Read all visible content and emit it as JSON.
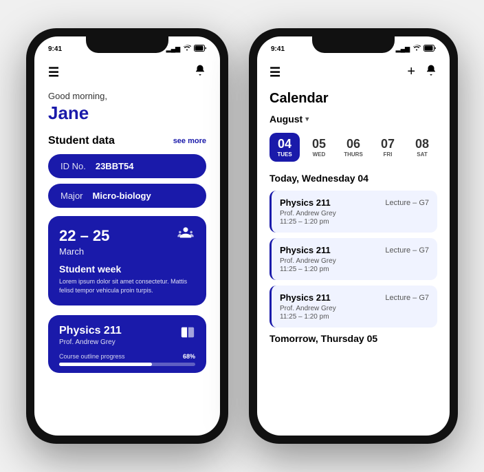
{
  "left_phone": {
    "status": {
      "time": "9:41",
      "signal": "▂▄▆",
      "wifi": "WiFi",
      "battery": "🔋"
    },
    "top_bar": {
      "menu_icon": "☰",
      "bell_icon": "🔔"
    },
    "greeting": {
      "sub": "Good morning,",
      "name": "Jane"
    },
    "student_data": {
      "title": "Student data",
      "see_more": "see more",
      "id_label": "ID No.",
      "id_value": "23BBT54",
      "major_label": "Major",
      "major_value": "Micro-biology"
    },
    "event": {
      "date": "22 – 25",
      "month": "March",
      "name": "Student week",
      "description": "Lorem ipsum dolor sit amet consectetur. Mattis felisd tempor vehicula proin turpis.",
      "icon": "🧑‍🏫"
    },
    "course": {
      "name": "Physics 211",
      "professor": "Prof. Andrew Grey",
      "progress_label": "Course outline progress",
      "progress_pct": 68,
      "icon": "📚"
    }
  },
  "right_phone": {
    "status": {
      "time": "9:41"
    },
    "top_bar": {
      "menu_icon": "☰",
      "plus_icon": "+",
      "bell_icon": "🔔"
    },
    "calendar": {
      "title": "Calendar",
      "month": "August",
      "days": [
        {
          "num": "04",
          "name": "TUES",
          "active": true
        },
        {
          "num": "05",
          "name": "WED",
          "active": false
        },
        {
          "num": "06",
          "name": "THURS",
          "active": false
        },
        {
          "num": "07",
          "name": "FRI",
          "active": false
        },
        {
          "num": "08",
          "name": "SAT",
          "active": false
        }
      ]
    },
    "today_label": "Today, Wednesday 04",
    "tomorrow_label": "Tomorrow, Thursday 05",
    "schedule": [
      {
        "course": "Physics 211",
        "type": "Lecture – G7",
        "professor": "Prof. Andrew Grey",
        "time": "11:25 – 1:20 pm"
      },
      {
        "course": "Physics 211",
        "type": "Lecture – G7",
        "professor": "Prof. Andrew Grey",
        "time": "11:25 – 1:20 pm"
      },
      {
        "course": "Physics 211",
        "type": "Lecture – G7",
        "professor": "Prof. Andrew Grey",
        "time": "11:25 – 1:20 pm"
      }
    ]
  }
}
